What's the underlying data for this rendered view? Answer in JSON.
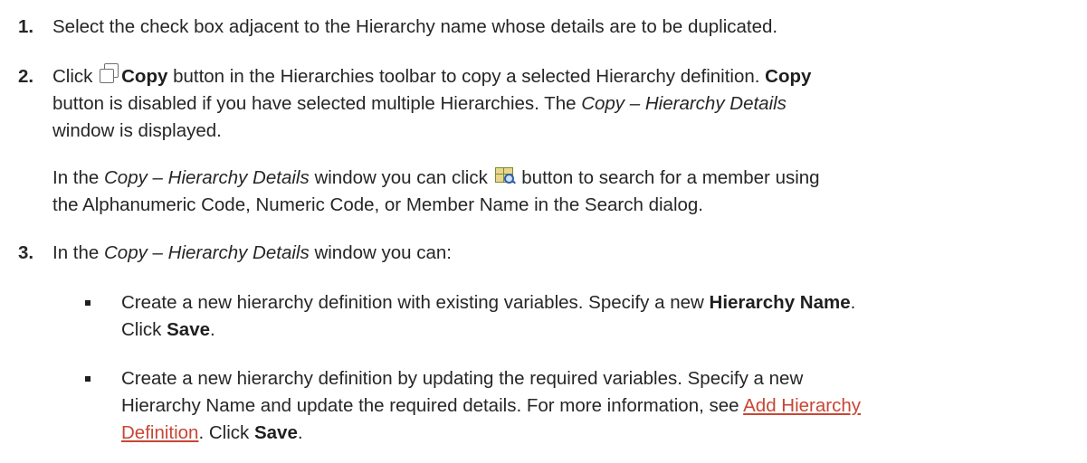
{
  "steps": [
    {
      "number": "1.",
      "text": "Select the check box adjacent to the Hierarchy name whose details are to be duplicated."
    },
    {
      "number": "2.",
      "click_word": "Click",
      "copy_label": "Copy",
      "text_a": " button in the Hierarchies toolbar to copy a selected Hierarchy definition.",
      "copy_label_2": "Copy",
      "text_b": "button is disabled if you have selected multiple Hierarchies. The",
      "window_name": "Copy – Hierarchy Details",
      "text_c": "window is displayed.",
      "para_in_the": "In the",
      "para_window_name": "Copy – Hierarchy Details",
      "para_text_a": "window you can click",
      "para_text_b": "button to search for a member using",
      "para_text_c": "the Alphanumeric Code, Numeric Code, or Member Name in the Search dialog."
    },
    {
      "number": "3.",
      "in_the": "In the",
      "window_name": "Copy – Hierarchy Details",
      "text": "window you can:",
      "bullets": [
        {
          "text_a": "Create a new hierarchy definition with existing variables. Specify a new",
          "bold_a": "Hierarchy Name",
          "text_b": ".",
          "click": "Click",
          "save": "Save",
          "end": "."
        },
        {
          "text_a": "Create a new hierarchy definition by updating the required variables. Specify a new",
          "text_b": "Hierarchy Name and update the required details. For more information, see",
          "link_a": "Add Hierarchy",
          "link_b": "Definition",
          "text_c": ". Click",
          "save": "Save",
          "end": "."
        }
      ]
    }
  ],
  "icons": {
    "copy": "copy-icon",
    "search": "search-member-icon"
  }
}
